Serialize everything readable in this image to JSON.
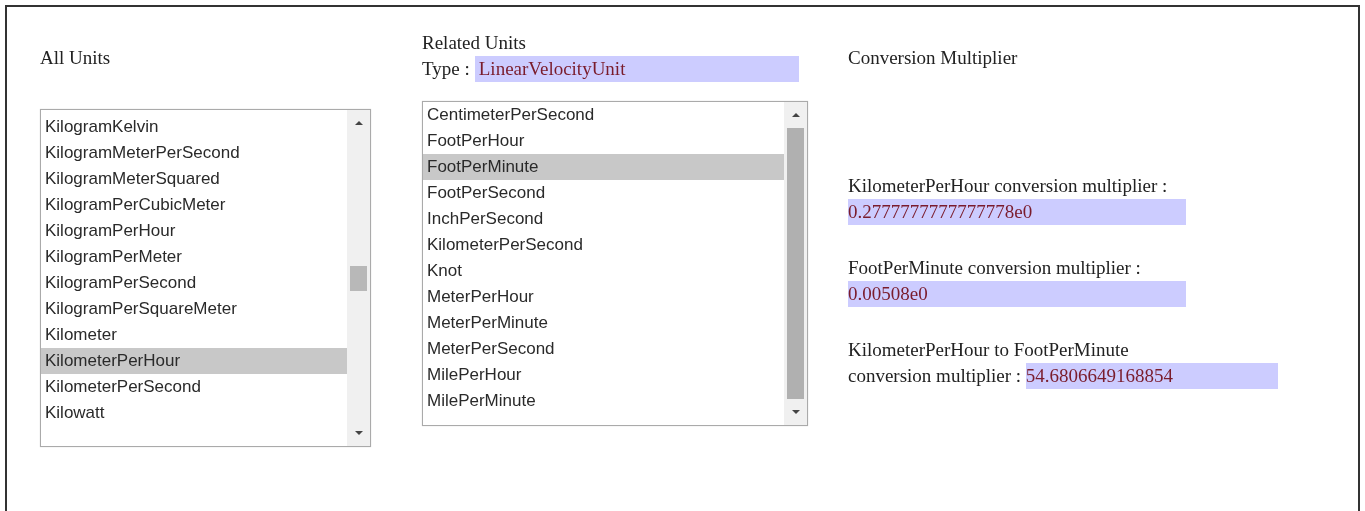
{
  "all_units": {
    "heading": "All Units",
    "items": [
      {
        "label": "KilogramKelvin",
        "selected": false
      },
      {
        "label": "KilogramMeterPerSecond",
        "selected": false
      },
      {
        "label": "KilogramMeterSquared",
        "selected": false
      },
      {
        "label": "KilogramPerCubicMeter",
        "selected": false
      },
      {
        "label": "KilogramPerHour",
        "selected": false
      },
      {
        "label": "KilogramPerMeter",
        "selected": false
      },
      {
        "label": "KilogramPerSecond",
        "selected": false
      },
      {
        "label": "KilogramPerSquareMeter",
        "selected": false
      },
      {
        "label": "Kilometer",
        "selected": false
      },
      {
        "label": "KilometerPerHour",
        "selected": true
      },
      {
        "label": "KilometerPerSecond",
        "selected": false
      },
      {
        "label": "Kilowatt",
        "selected": false
      }
    ]
  },
  "related_units": {
    "heading": "Related Units",
    "type_label": "Type :",
    "type_value": "LinearVelocityUnit",
    "items": [
      {
        "label": "CentimeterPerSecond",
        "selected": false
      },
      {
        "label": "FootPerHour",
        "selected": false
      },
      {
        "label": "FootPerMinute",
        "selected": true
      },
      {
        "label": "FootPerSecond",
        "selected": false
      },
      {
        "label": "InchPerSecond",
        "selected": false
      },
      {
        "label": "KilometerPerSecond",
        "selected": false
      },
      {
        "label": "Knot",
        "selected": false
      },
      {
        "label": "MeterPerHour",
        "selected": false
      },
      {
        "label": "MeterPerMinute",
        "selected": false
      },
      {
        "label": "MeterPerSecond",
        "selected": false
      },
      {
        "label": "MilePerHour",
        "selected": false
      },
      {
        "label": "MilePerMinute",
        "selected": false
      }
    ]
  },
  "conversion": {
    "heading": "Conversion Multiplier",
    "results": [
      {
        "kind": "block",
        "label": [
          "KilometerPerHour conversion multiplier :"
        ],
        "value": "0.2777777777777778e0"
      },
      {
        "kind": "block",
        "label": [
          "FootPerMinute conversion multiplier :"
        ],
        "value": "0.00508e0"
      },
      {
        "kind": "inline",
        "label": [
          "KilometerPerHour to FootPerMinute",
          "conversion multiplier :"
        ],
        "value": "54.6806649168854"
      }
    ]
  }
}
